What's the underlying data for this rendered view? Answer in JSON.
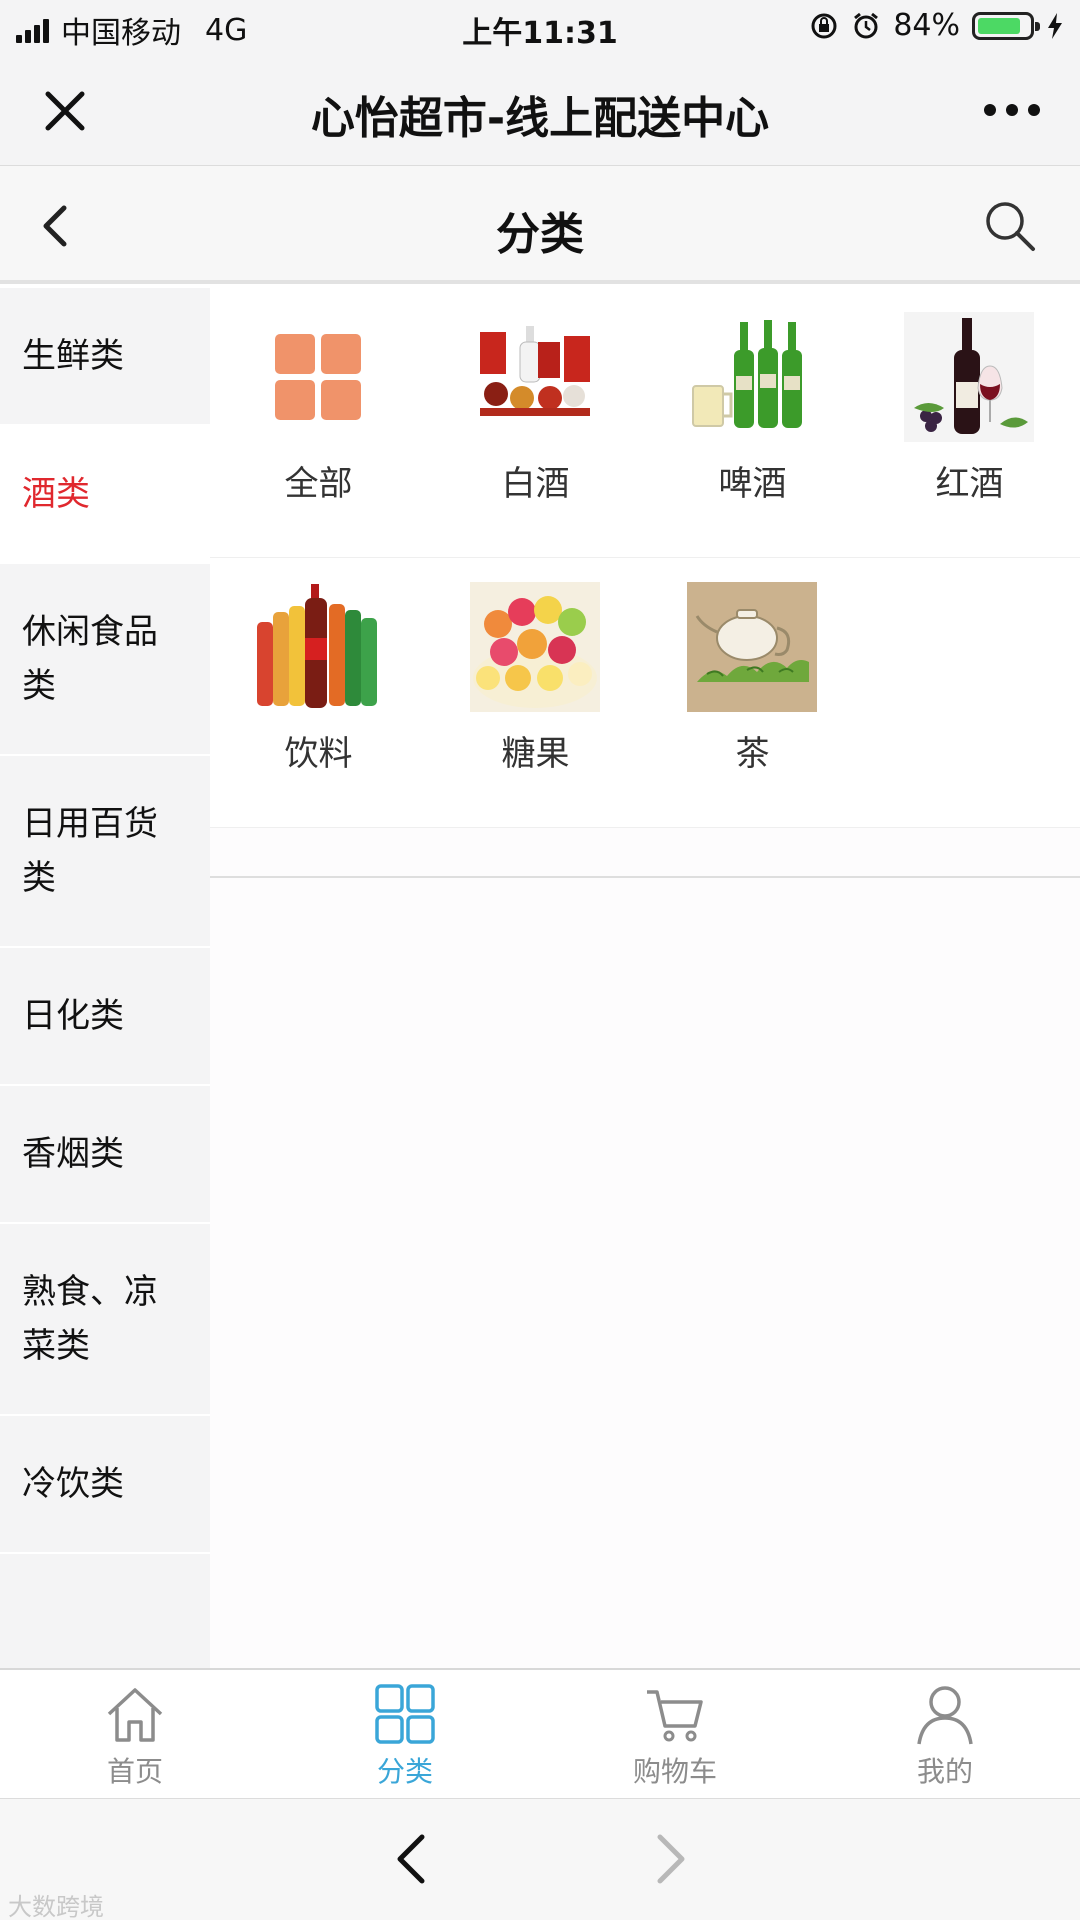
{
  "status_bar": {
    "carrier": "中国移动",
    "network": "4G",
    "time": "上午11:31",
    "battery_percent": "84%",
    "battery_level": 0.84
  },
  "app_bar": {
    "title": "心怡超市-线上配送中心",
    "close_icon": "close-icon",
    "more_icon": "more-dots-icon"
  },
  "page_header": {
    "title": "分类",
    "back_icon": "chevron-left-icon",
    "search_icon": "search-icon"
  },
  "sidebar": {
    "items": [
      {
        "label": "生鲜类"
      },
      {
        "label": "酒类"
      },
      {
        "label": "休闲食品类"
      },
      {
        "label": "日用百货类"
      },
      {
        "label": "日化类"
      },
      {
        "label": "香烟类"
      },
      {
        "label": "熟食、凉菜类"
      },
      {
        "label": "冷饮类"
      }
    ],
    "active_index": 1,
    "active_color": "#e0282e"
  },
  "categories": [
    {
      "label": "全部",
      "icon": "all-grid-icon"
    },
    {
      "label": "白酒",
      "icon": "baijiu-image"
    },
    {
      "label": "啤酒",
      "icon": "beer-image"
    },
    {
      "label": "红酒",
      "icon": "red-wine-image"
    },
    {
      "label": "饮料",
      "icon": "drinks-image"
    },
    {
      "label": "糖果",
      "icon": "candy-image"
    },
    {
      "label": "茶",
      "icon": "tea-image"
    }
  ],
  "tab_bar": {
    "tabs": [
      {
        "label": "首页",
        "icon": "home-icon"
      },
      {
        "label": "分类",
        "icon": "category-grid-icon"
      },
      {
        "label": "购物车",
        "icon": "cart-icon"
      },
      {
        "label": "我的",
        "icon": "user-icon"
      }
    ],
    "active_index": 1,
    "active_color": "#3aa6d8"
  },
  "system_nav": {
    "back_icon": "nav-back-icon",
    "forward_icon": "nav-forward-icon"
  },
  "watermark": "大数跨境"
}
